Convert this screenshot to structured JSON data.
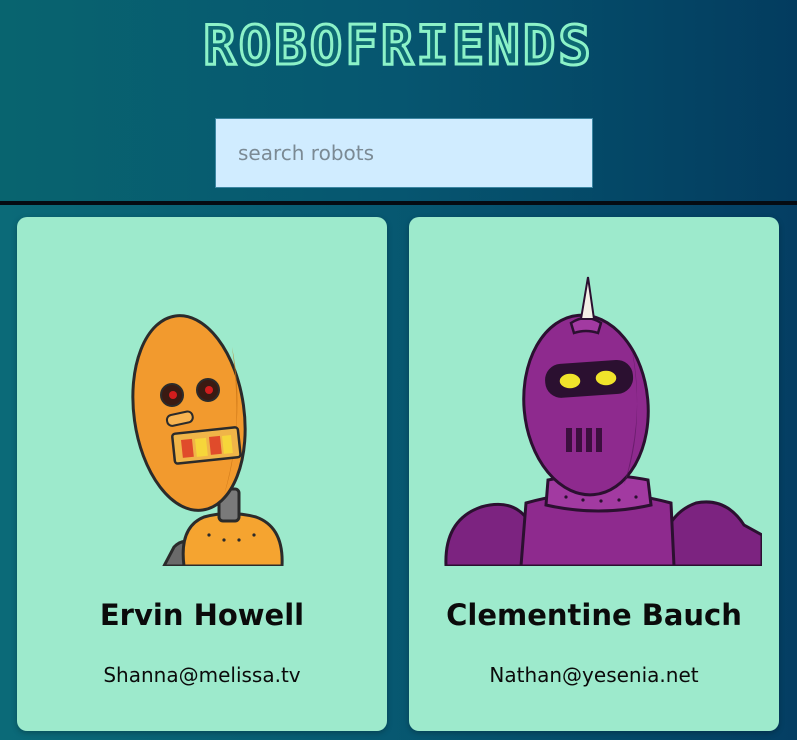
{
  "header": {
    "title": "ROBOFRIENDS"
  },
  "search": {
    "placeholder": "search robots",
    "value": ""
  },
  "robots": [
    {
      "name": "Ervin Howell",
      "email": "Shanna@melissa.tv",
      "avatar_color": "#f29a2e",
      "avatar_icon": "orange-robot-avatar-icon"
    },
    {
      "name": "Clementine Bauch",
      "email": "Nathan@yesenia.net",
      "avatar_color": "#8e2a8e",
      "avatar_icon": "purple-robot-avatar-icon"
    }
  ],
  "colors": {
    "background_left": "#0b6a78",
    "background_right": "#043e63",
    "title": "#8cf2c8",
    "search_bg": "#d0ecff",
    "card_bg": "#9deacc"
  }
}
